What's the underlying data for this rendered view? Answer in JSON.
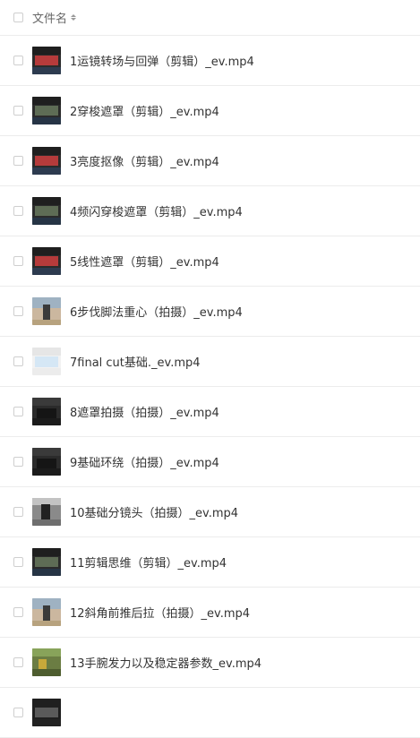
{
  "header": {
    "column_label": "文件名"
  },
  "files": [
    {
      "name": "1运镜转场与回弹（剪辑）_ev.mp4",
      "thumb": "t-edit-red"
    },
    {
      "name": "2穿梭遮罩（剪辑）_ev.mp4",
      "thumb": "t-edit-green"
    },
    {
      "name": "3亮度抠像（剪辑）_ev.mp4",
      "thumb": "t-edit-red"
    },
    {
      "name": "4频闪穿梭遮罩（剪辑）_ev.mp4",
      "thumb": "t-edit-green"
    },
    {
      "name": "5线性遮罩（剪辑）_ev.mp4",
      "thumb": "t-edit-red"
    },
    {
      "name": "6步伐脚法重心（拍摄）_ev.mp4",
      "thumb": "t-outdoor"
    },
    {
      "name": "7final cut基础._ev.mp4",
      "thumb": "t-fcp"
    },
    {
      "name": "8遮罩拍摄（拍摄）_ev.mp4",
      "thumb": "t-car"
    },
    {
      "name": "9基础环绕（拍摄）_ev.mp4",
      "thumb": "t-car"
    },
    {
      "name": "10基础分镜头（拍摄）_ev.mp4",
      "thumb": "t-street"
    },
    {
      "name": "11剪辑思维（剪辑）_ev.mp4",
      "thumb": "t-edit-green"
    },
    {
      "name": "12斜角前推后拉（拍摄）_ev.mp4",
      "thumb": "t-outdoor"
    },
    {
      "name": "13手腕发力以及稳定器参数_ev.mp4",
      "thumb": "t-garden"
    },
    {
      "name": "",
      "thumb": "t-dark"
    }
  ]
}
